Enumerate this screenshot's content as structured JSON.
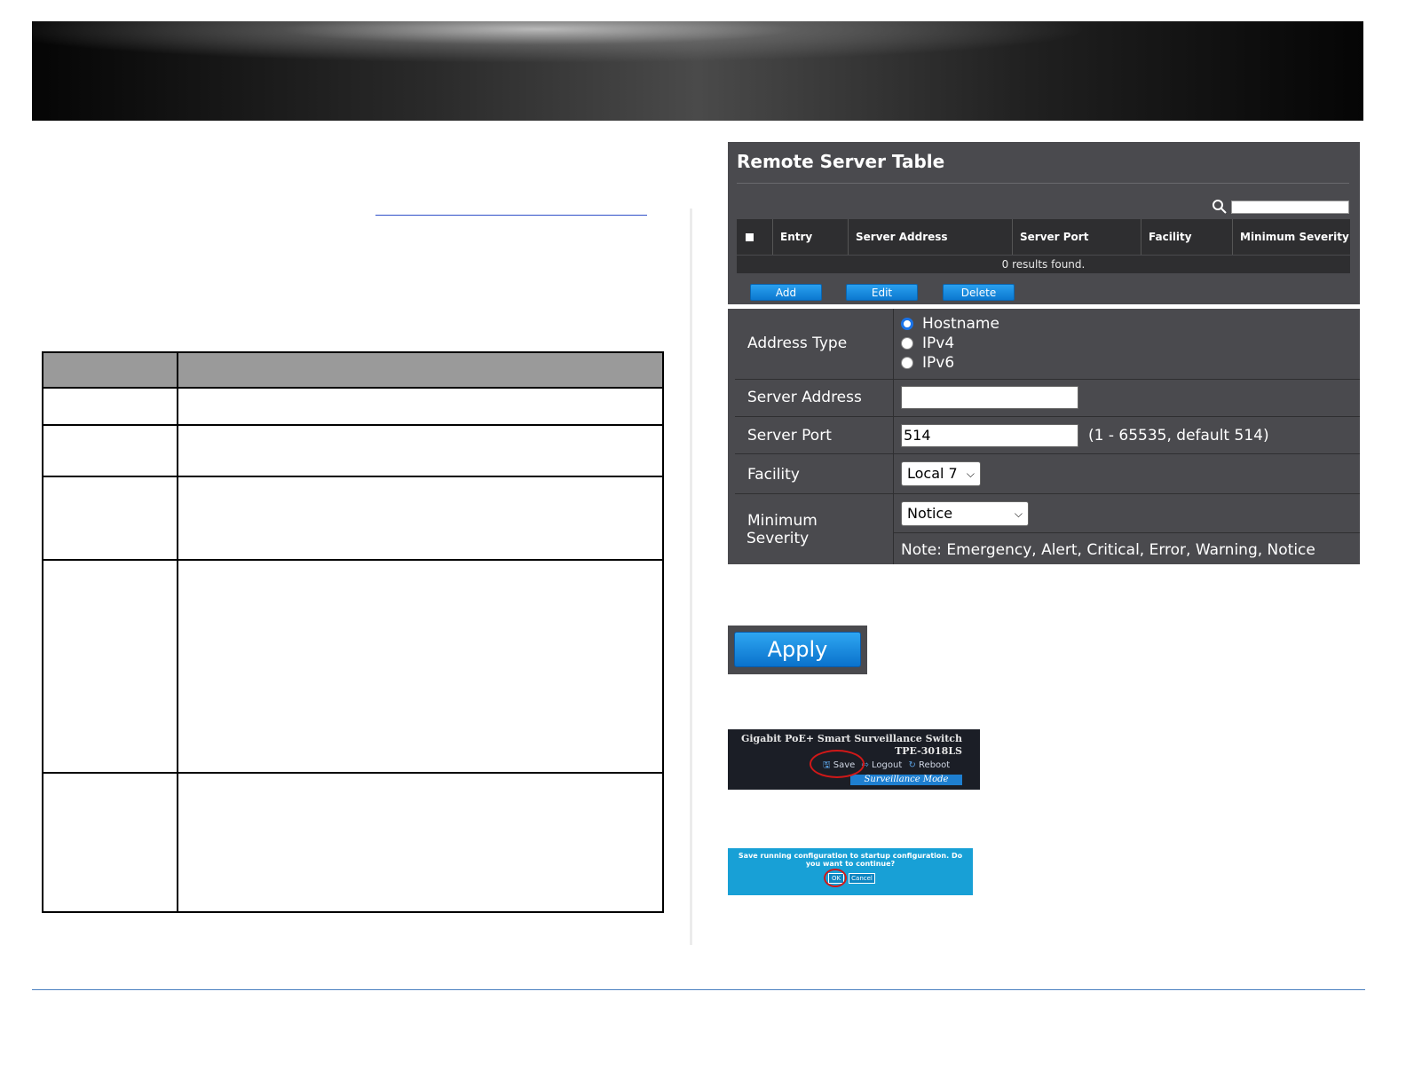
{
  "remote_server_table": {
    "title": "Remote Server Table",
    "columns": [
      "Entry",
      "Server Address",
      "Server Port",
      "Facility",
      "Minimum Severity"
    ],
    "results_text": "0 results found.",
    "buttons": {
      "add": "Add",
      "edit": "Edit",
      "delete": "Delete"
    }
  },
  "form": {
    "address_type": {
      "label": "Address Type",
      "options": [
        "Hostname",
        "IPv4",
        "IPv6"
      ],
      "selected": "Hostname"
    },
    "server_address": {
      "label": "Server Address",
      "value": ""
    },
    "server_port": {
      "label": "Server Port",
      "value": "514",
      "hint": "(1 - 65535, default 514)"
    },
    "facility": {
      "label": "Facility",
      "selected": "Local 7"
    },
    "minimum_severity": {
      "label_line1": "Minimum",
      "label_line2": "Severity",
      "selected": "Notice",
      "note": "Note: Emergency, Alert, Critical, Error, Warning, Notice"
    }
  },
  "apply_button": "Apply",
  "header_screenshot": {
    "line1": "Gigabit PoE+ Smart Surveillance Switch",
    "line2": "TPE-3018LS",
    "save": "Save",
    "logout": "Logout",
    "reboot": "Reboot",
    "mode": "Surveillance Mode"
  },
  "confirm_dialog": {
    "message": "Save running configuration to startup configuration. Do you want to continue?",
    "ok": "OK",
    "cancel": "Cancel"
  },
  "colors": {
    "panel_bg": "#4a4a4e",
    "header_row": "#2e2e30",
    "button_blue": "#1a8de0",
    "dialog_blue": "#18a0d6",
    "highlight_red": "#d01818"
  }
}
